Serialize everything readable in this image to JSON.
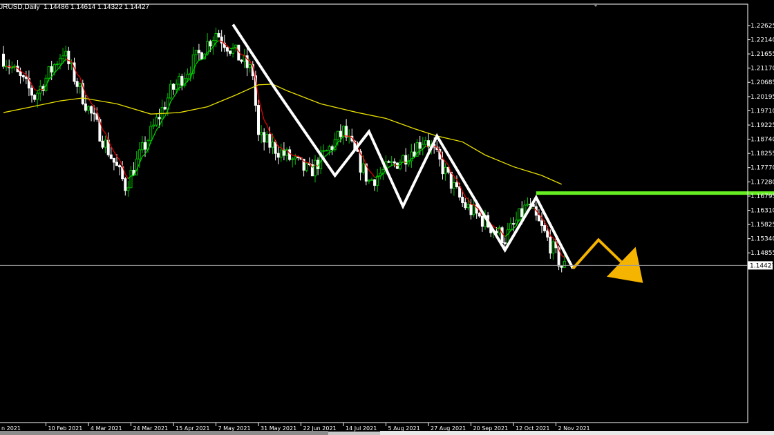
{
  "header": {
    "symbol_label": "URUSD,Daily",
    "ohlc_values": "1.14486 1.14614 1.14322 1.14427"
  },
  "colors": {
    "background": "#000000",
    "frame": "#ffffff",
    "bull_candle": "#00c000",
    "bear_candle": "#ffffff",
    "ma_fast": "#00d000",
    "ma_fast_down": "#e00000",
    "ma_slow": "#e8e000",
    "zigzag": "#ffffff",
    "resistance": "#66ee22",
    "projection": "#f5b400"
  },
  "chart_data": {
    "type": "candlestick",
    "symbol": "EURUSD",
    "timeframe": "Daily",
    "y_ticks": [
      "1.22625",
      "1.22140",
      "1.21655",
      "1.21170",
      "1.20685",
      "1.20195",
      "1.19710",
      "1.19225",
      "1.18740",
      "1.18255",
      "1.17770",
      "1.17280",
      "1.16795",
      "1.16310",
      "1.15825",
      "1.15340",
      "1.14855"
    ],
    "ylim": [
      1.141,
      1.229
    ],
    "current_price": "1.14427",
    "x_ticks": [
      "n 2021",
      "10 Feb 2021",
      "4 Mar 2021",
      "24 Mar 2021",
      "15 Apr 2021",
      "7 May 2021",
      "31 May 2021",
      "22 Jun 2021",
      "14 Jul 2021",
      "5 Aug 2021",
      "27 Aug 2021",
      "20 Sep 2021",
      "12 Oct 2021",
      "2 Nov 2021"
    ],
    "x_tick_index": [
      0,
      15,
      30,
      45,
      60,
      75,
      90,
      105,
      120,
      135,
      150,
      165,
      180,
      195
    ],
    "bar_count": 210,
    "price_path": [
      [
        0,
        1.2165
      ],
      [
        12,
        1.202
      ],
      [
        22,
        1.2175
      ],
      [
        30,
        1.1998
      ],
      [
        44,
        1.1715
      ],
      [
        60,
        1.2035
      ],
      [
        76,
        1.224
      ],
      [
        85,
        1.2145
      ],
      [
        89,
        1.21
      ],
      [
        91,
        1.188
      ],
      [
        96,
        1.185
      ],
      [
        109,
        1.176
      ],
      [
        121,
        1.19
      ],
      [
        130,
        1.173
      ],
      [
        142,
        1.181
      ],
      [
        150,
        1.188
      ],
      [
        163,
        1.1655
      ],
      [
        178,
        1.1535
      ],
      [
        186,
        1.165
      ],
      [
        192,
        1.155
      ],
      [
        198,
        1.144
      ]
    ],
    "slow_ma": [
      [
        0,
        1.1965
      ],
      [
        10,
        1.1985
      ],
      [
        20,
        1.2005
      ],
      [
        28,
        1.2015
      ],
      [
        40,
        1.1995
      ],
      [
        52,
        1.196
      ],
      [
        62,
        1.1965
      ],
      [
        72,
        1.1985
      ],
      [
        82,
        1.2025
      ],
      [
        90,
        1.206
      ],
      [
        95,
        1.2062
      ],
      [
        100,
        1.204
      ],
      [
        112,
        1.1995
      ],
      [
        125,
        1.1965
      ],
      [
        135,
        1.1945
      ],
      [
        145,
        1.191
      ],
      [
        153,
        1.1885
      ],
      [
        162,
        1.1865
      ],
      [
        170,
        1.182
      ],
      [
        180,
        1.178
      ],
      [
        190,
        1.175
      ],
      [
        197,
        1.172
      ]
    ],
    "zigzag": [
      [
        81,
        1.2266
      ],
      [
        96,
        1.2045
      ],
      [
        117,
        1.175
      ],
      [
        129,
        1.19
      ],
      [
        141,
        1.1645
      ],
      [
        153,
        1.1885
      ],
      [
        177,
        1.1495
      ],
      [
        188,
        1.1675
      ],
      [
        201,
        1.1432
      ]
    ],
    "resistance_level": 1.169,
    "resistance_from_bar": 188,
    "projection": [
      [
        201,
        1.1432
      ],
      [
        210,
        1.153
      ],
      [
        218,
        1.1455
      ]
    ]
  }
}
